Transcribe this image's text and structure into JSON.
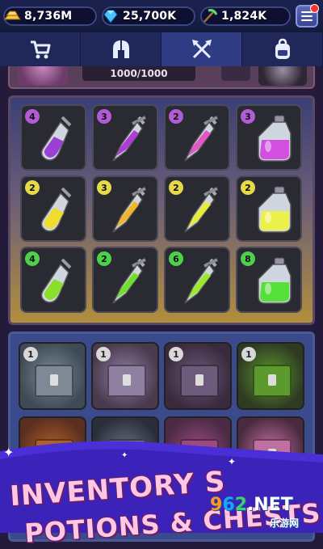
{
  "currencies": [
    {
      "icon": "gold-bars-icon",
      "value": "8,736M"
    },
    {
      "icon": "gems-icon",
      "value": "25,700K"
    },
    {
      "icon": "pickaxe-ore-icon",
      "value": "1,824K"
    }
  ],
  "tabs": [
    {
      "icon": "cart-icon",
      "active": false
    },
    {
      "icon": "helmet-icon",
      "active": false
    },
    {
      "icon": "crossed-arrows-icon",
      "active": true
    },
    {
      "icon": "backpack-icon",
      "active": false
    }
  ],
  "strip": {
    "progress_text": "1000/1000"
  },
  "potions": [
    {
      "count": "4",
      "badge_color": "#b25bd6",
      "liquid": "#9b3fd6",
      "shape": "vial"
    },
    {
      "count": "3",
      "badge_color": "#b25bd6",
      "liquid": "#b23ad6",
      "shape": "sword"
    },
    {
      "count": "2",
      "badge_color": "#b25bd6",
      "liquid": "#e455c8",
      "shape": "sword"
    },
    {
      "count": "3",
      "badge_color": "#b25bd6",
      "liquid": "#d24fe0",
      "shape": "flask"
    },
    {
      "count": "2",
      "badge_color": "#e6d94a",
      "liquid": "#f0dc2a",
      "shape": "vial"
    },
    {
      "count": "3",
      "badge_color": "#e6d94a",
      "liquid": "#f0b72a",
      "shape": "sword"
    },
    {
      "count": "2",
      "badge_color": "#e6d94a",
      "liquid": "#e7ec3a",
      "shape": "sword"
    },
    {
      "count": "2",
      "badge_color": "#e6d94a",
      "liquid": "#ecf04a",
      "shape": "flask"
    },
    {
      "count": "4",
      "badge_color": "#4fd04a",
      "liquid": "#8adf2a",
      "shape": "vial"
    },
    {
      "count": "2",
      "badge_color": "#4fd04a",
      "liquid": "#6fe02a",
      "shape": "sword"
    },
    {
      "count": "6",
      "badge_color": "#4fd04a",
      "liquid": "#9bea2a",
      "shape": "sword"
    },
    {
      "count": "8",
      "badge_color": "#4fd04a",
      "liquid": "#58e03a",
      "shape": "flask"
    }
  ],
  "chests": [
    {
      "count": "1",
      "bg": "#3e4a56",
      "chest": "#7d8a96"
    },
    {
      "count": "1",
      "bg": "#4a3a4e",
      "chest": "#8f7fa0"
    },
    {
      "count": "1",
      "bg": "#3a2a3e",
      "chest": "#6e5a7a"
    },
    {
      "count": "1",
      "bg": "#2e3a22",
      "chest": "#5c9a2e"
    },
    {
      "count": "",
      "bg": "#5a2e20",
      "chest": "#b0602a"
    },
    {
      "count": "",
      "bg": "#2a2e3a",
      "chest": "#6a7080"
    },
    {
      "count": "",
      "bg": "#4a2a44",
      "chest": "#9a4a80"
    },
    {
      "count": "",
      "bg": "#4a2a40",
      "chest": "#c070a0"
    }
  ],
  "banner": {
    "line1": "INVENTORY S",
    "line2": "POTIONS & CHESTS"
  },
  "watermark": {
    "part1": "9",
    "part2": "6",
    "part3": "2",
    "suffix": ".NET",
    "sub": "乐游网"
  }
}
